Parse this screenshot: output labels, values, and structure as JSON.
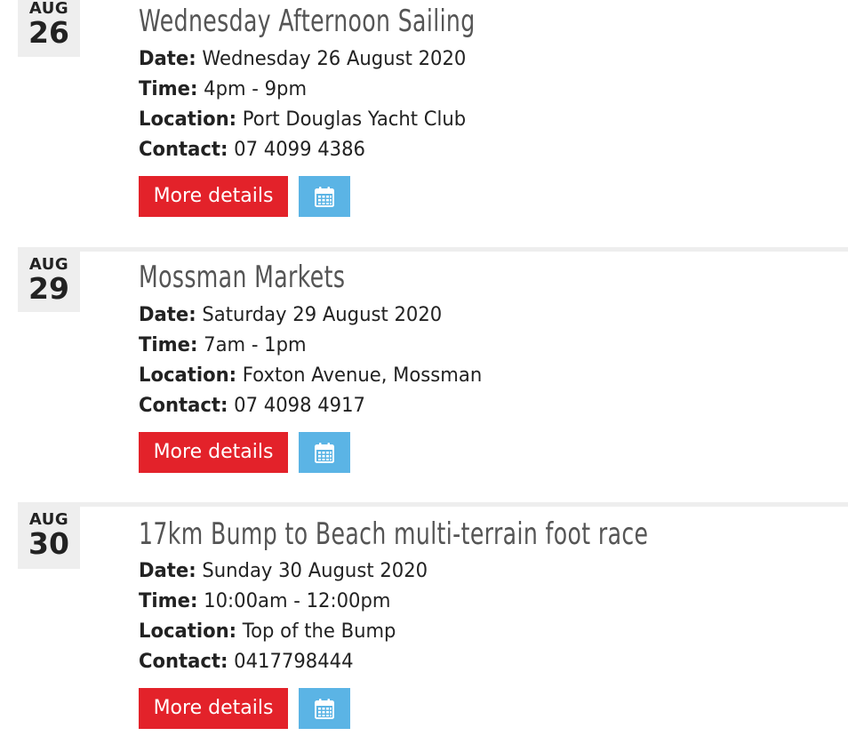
{
  "events": [
    {
      "month": "AUG",
      "day": "26",
      "title": "Wednesday Afternoon Sailing",
      "date_label": "Date:",
      "date_value": "Wednesday 26 August 2020",
      "time_label": "Time:",
      "time_value": "4pm - 9pm",
      "location_label": "Location:",
      "location_value": "Port Douglas Yacht Club",
      "contact_label": "Contact:",
      "contact_value": "07 4099 4386",
      "more_label": "More details",
      "calendar_icon": "calendar-icon"
    },
    {
      "month": "AUG",
      "day": "29",
      "title": "Mossman Markets",
      "date_label": "Date:",
      "date_value": "Saturday 29 August 2020",
      "time_label": "Time:",
      "time_value": "7am - 1pm",
      "location_label": "Location:",
      "location_value": "Foxton Avenue, Mossman",
      "contact_label": "Contact:",
      "contact_value": "07 4098 4917",
      "more_label": "More details",
      "calendar_icon": "calendar-icon"
    },
    {
      "month": "AUG",
      "day": "30",
      "title": "17km Bump to Beach multi-terrain foot race",
      "date_label": "Date:",
      "date_value": "Sunday 30 August 2020",
      "time_label": "Time:",
      "time_value": "10:00am - 12:00pm",
      "location_label": "Location:",
      "location_value": "Top of the Bump",
      "contact_label": "Contact:",
      "contact_value": "0417798444",
      "more_label": "More details",
      "calendar_icon": "calendar-icon"
    }
  ],
  "colors": {
    "more_button": "#e3222a",
    "calendar_button": "#5bb4e5",
    "title_text": "#555555",
    "badge_bg": "#eeeeee"
  }
}
